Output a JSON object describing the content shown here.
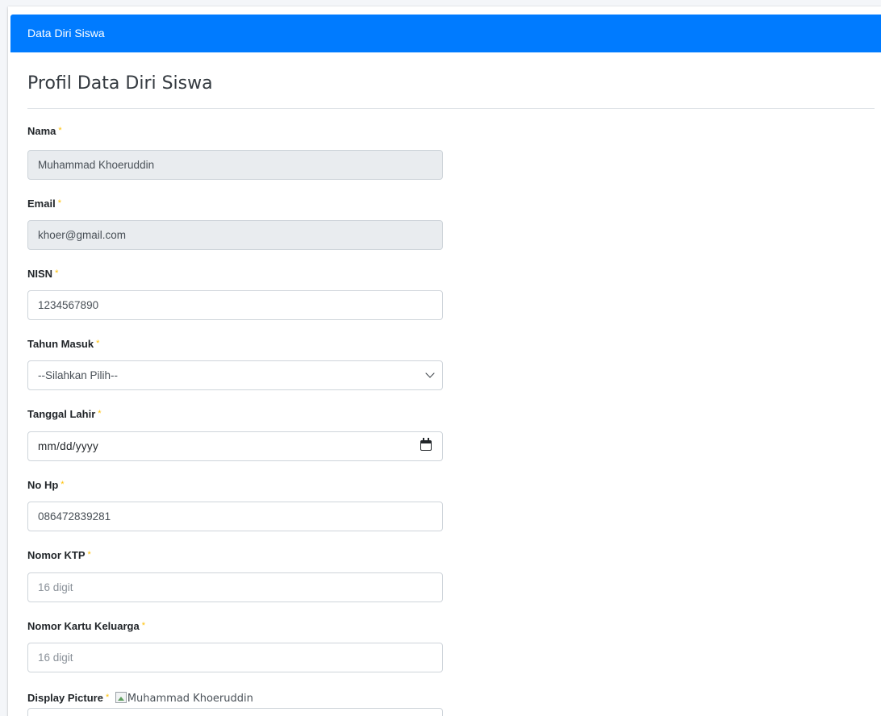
{
  "header": {
    "title": "Data Diri Siswa"
  },
  "page_title": "Profil Data Diri Siswa",
  "required_marker": "*",
  "fields": {
    "nama": {
      "label": "Nama",
      "value": "Muhammad Khoeruddin"
    },
    "email": {
      "label": "Email",
      "value": "khoer@gmail.com"
    },
    "nisn": {
      "label": "NISN",
      "value": "1234567890"
    },
    "tahun_masuk": {
      "label": "Tahun Masuk",
      "selected": "--Silahkan Pilih--"
    },
    "tanggal_lahir": {
      "label": "Tanggal Lahir",
      "placeholder": "mm/dd/yyyy"
    },
    "no_hp": {
      "label": "No Hp",
      "value": "086472839281"
    },
    "nomor_ktp": {
      "label": "Nomor KTP",
      "placeholder": "16 digit"
    },
    "nomor_kk": {
      "label": "Nomor Kartu Keluarga",
      "placeholder": "16 digit"
    },
    "display_picture": {
      "label": "Display Picture",
      "image_alt": "Muhammad Khoeruddin"
    }
  },
  "colors": {
    "header_bg": "#007bff",
    "required": "#ffc107",
    "readonly_bg": "#e9ecef"
  },
  "icons": {
    "select": "chevron-down-icon",
    "date": "calendar-icon",
    "broken_image": "broken-image-icon"
  }
}
